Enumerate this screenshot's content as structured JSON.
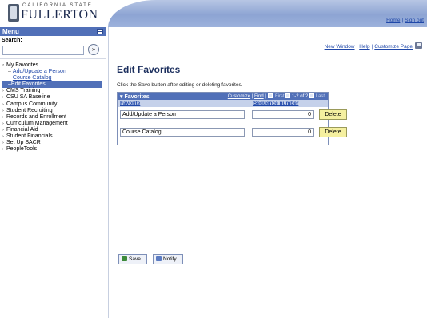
{
  "header": {
    "logo_csu": "CALIFORNIA STATE",
    "logo_name": "FULLERTON",
    "links": [
      "Home",
      "Sign out"
    ]
  },
  "sidebar": {
    "menu_label": "Menu",
    "search_label": "Search:",
    "search_value": "",
    "search_go": "»",
    "tree": [
      {
        "label": "My Favorites",
        "expanded": true
      },
      {
        "label": "Add/Update a Person",
        "sub": true
      },
      {
        "label": "Course Catalog",
        "sub": true
      },
      {
        "label": "Edit Favorites",
        "sub": true,
        "selected": true
      },
      {
        "label": "CMS Training"
      },
      {
        "label": "CSU SA Baseline"
      },
      {
        "label": "Campus Community"
      },
      {
        "label": "Student Recruiting"
      },
      {
        "label": "Records and Enrollment"
      },
      {
        "label": "Curriculum Management"
      },
      {
        "label": "Financial Aid"
      },
      {
        "label": "Student Financials"
      },
      {
        "label": "Set Up SACR"
      },
      {
        "label": "PeopleTools"
      }
    ]
  },
  "main": {
    "links": [
      "New Window",
      "Help",
      "Customize Page"
    ],
    "title": "Edit Favorites",
    "instructions": "Click the Save button after editing or deleting favorites.",
    "grid": {
      "title": "Favorites",
      "customize": "Customize",
      "find": "Find",
      "first": "First",
      "range": "1-2 of 2",
      "last": "Last",
      "col_favorite": "Favorite",
      "col_sequence": "Sequence number",
      "rows": [
        {
          "favorite": "Add/Update a Person",
          "sequence": "0",
          "action": "Delete"
        },
        {
          "favorite": "Course Catalog",
          "sequence": "0",
          "action": "Delete"
        }
      ]
    },
    "buttons": {
      "save": "Save",
      "notify": "Notify"
    }
  },
  "colors": {
    "header_band": "#9db2dc",
    "menu_bar": "#5170b8",
    "link": "#1f47a8",
    "delete_button": "#f5f0a0"
  }
}
